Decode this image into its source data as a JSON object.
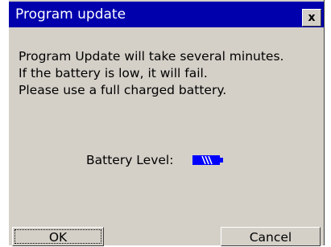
{
  "dialog": {
    "title": "Program update",
    "close_label": "x",
    "message": [
      "Program Update will take several minutes.",
      "If the battery is low, it will fail.",
      "Please use a full charged battery."
    ],
    "battery_label": "Battery Level:",
    "battery_icon": "battery-charging-icon",
    "ok_label": "OK",
    "cancel_label": "Cancel"
  },
  "colors": {
    "titlebar": "#0000ad",
    "face": "#d4d0c8",
    "battery": "#0000ff"
  }
}
